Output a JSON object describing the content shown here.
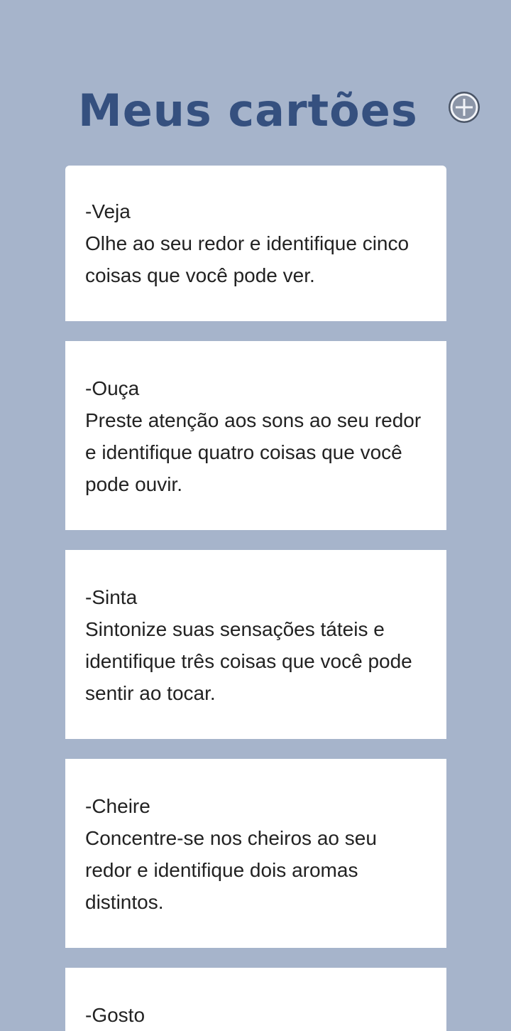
{
  "header": {
    "title": "Meus cartões",
    "add_icon": "plus-circle-icon"
  },
  "colors": {
    "background": "#a6b4cb",
    "title": "#35507f",
    "card": "#ffffff",
    "text": "#222222"
  },
  "cards": [
    {
      "label": "-Veja",
      "text": "Olhe ao seu redor e identifique cinco coisas que você pode ver."
    },
    {
      "label": "-Ouça",
      "text": "Preste atenção aos sons ao seu redor e identifique quatro coisas que você pode ouvir."
    },
    {
      "label": "-Sinta",
      "text": "Sintonize suas sensações táteis e identifique três coisas que você pode sentir ao tocar."
    },
    {
      "label": "-Cheire",
      "text": "Concentre-se nos cheiros ao seu redor e identifique dois aromas distintos."
    },
    {
      "label": "-Gosto",
      "text": ""
    }
  ]
}
